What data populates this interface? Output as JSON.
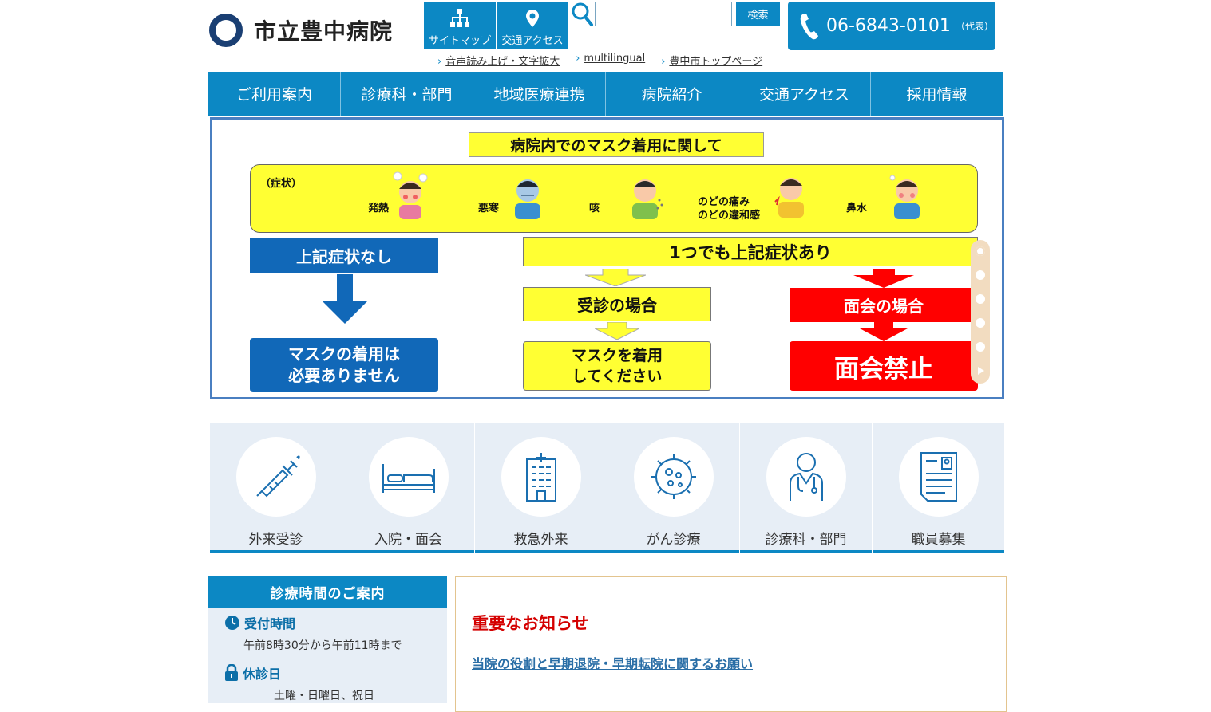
{
  "header": {
    "logo_text": "市立豊中病院",
    "buttons": [
      {
        "label": "サイトマップ",
        "icon": "sitemap-icon"
      },
      {
        "label": "交通アクセス",
        "icon": "map-pin-icon"
      }
    ],
    "search": {
      "value": "",
      "placeholder": "",
      "button_label": "検索"
    },
    "phone": {
      "number": "06-6843-0101",
      "note": "（代表）"
    },
    "sublinks": [
      "音声読み上げ・文字拡大",
      "multilingual",
      "豊中市トップページ"
    ]
  },
  "nav": {
    "items": [
      "ご利用案内",
      "診療科・部門",
      "地域医療連携",
      "病院紹介",
      "交通アクセス",
      "採用情報"
    ]
  },
  "banner": {
    "title": "病院内でのマスク着用に関して",
    "symptoms_heading": "（症状）",
    "symptoms": [
      "発熱",
      "悪寒",
      "咳",
      "のどの痛み",
      "のどの違和感",
      "鼻水"
    ],
    "no_symptom_label": "上記症状なし",
    "no_symptom_result_line1": "マスクの着用は",
    "no_symptom_result_line2": "必要ありません",
    "has_symptom_label": "1つでも上記症状あり",
    "visit_label": "受診の場合",
    "visit_result_line1": "マスクを着用",
    "visit_result_line2": "してください",
    "meeting_label": "面会の場合",
    "meeting_result": "面会禁止",
    "slide_count": 5,
    "active_slide": 1,
    "colors": {
      "yellow": "#ffff33",
      "blue": "#1168b8",
      "red": "#ff0000"
    }
  },
  "tiles": [
    {
      "label": "外来受診",
      "icon": "syringe-icon"
    },
    {
      "label": "入院・面会",
      "icon": "bed-icon"
    },
    {
      "label": "救急外来",
      "icon": "hospital-building-icon"
    },
    {
      "label": "がん診療",
      "icon": "cell-icon"
    },
    {
      "label": "診療科・部門",
      "icon": "doctor-icon"
    },
    {
      "label": "職員募集",
      "icon": "resume-icon"
    }
  ],
  "hours": {
    "heading": "診療時間のご案内",
    "reception_label": "受付時間",
    "reception_value": "午前8時30分から午前11時まで",
    "closed_label": "休診日",
    "closed_value": "土曜・日曜日、祝日"
  },
  "notice": {
    "title": "重要なお知らせ",
    "links": [
      "当院の役割と早期退院・早期転院に関するお願い"
    ]
  },
  "theme": {
    "accent": "#0c88c4",
    "notice_red": "#d40000",
    "tile_bg": "#e7eef6"
  }
}
